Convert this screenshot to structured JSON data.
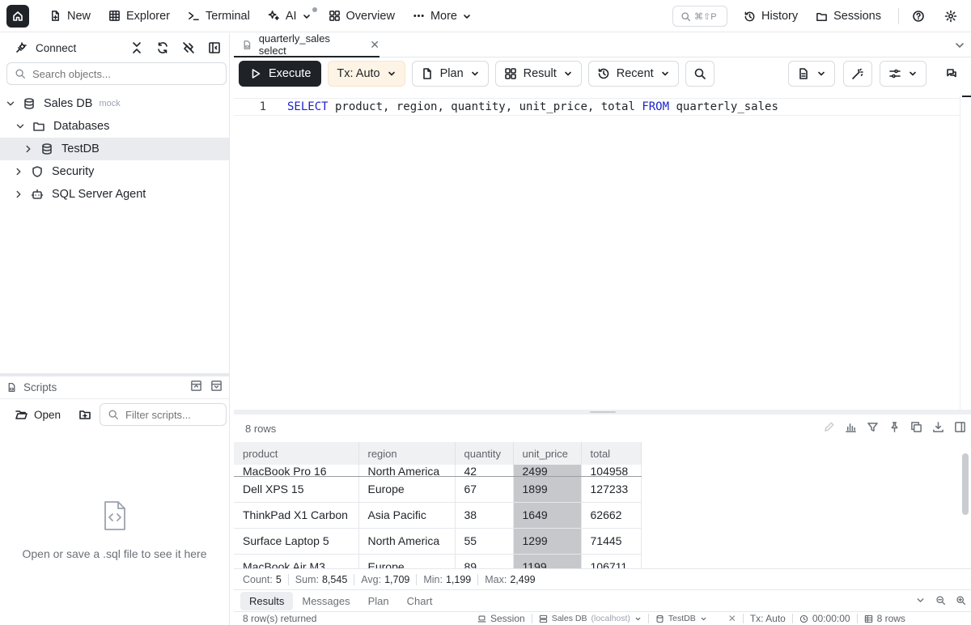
{
  "topnav": {
    "items": [
      {
        "label": "New",
        "icon": "new-file-icon"
      },
      {
        "label": "Explorer",
        "icon": "grid-table-icon"
      },
      {
        "label": "Terminal",
        "icon": "terminal-icon"
      },
      {
        "label": "AI",
        "icon": "sparkles-icon"
      },
      {
        "label": "Overview",
        "icon": "overview-grid-icon"
      },
      {
        "label": "More",
        "icon": "more-dots-icon"
      }
    ],
    "command_shortcut": "⌘⇧P",
    "history_label": "History",
    "sessions_label": "Sessions"
  },
  "connect": {
    "title": "Connect",
    "search_placeholder": "Search objects...",
    "tree": [
      {
        "label": "Sales DB",
        "badge": "mock"
      },
      {
        "label": "Databases"
      },
      {
        "label": "TestDB"
      },
      {
        "label": "Security"
      },
      {
        "label": "SQL Server Agent"
      }
    ]
  },
  "scripts": {
    "title": "Scripts",
    "open_label": "Open",
    "filter_placeholder": "Filter scripts...",
    "empty_text": "Open or save a .sql file to see it here"
  },
  "editor": {
    "tab_title": "quarterly_sales select",
    "toolbar": {
      "execute": "Execute",
      "tx": "Tx: Auto",
      "plan": "Plan",
      "result": "Result",
      "recent": "Recent"
    },
    "line_number": "1",
    "code": {
      "kw_select": "SELECT",
      "columns": " product, region, quantity, unit_price, total ",
      "kw_from": "FROM",
      "table": " quarterly_sales"
    }
  },
  "results": {
    "row_count_label": "8 rows",
    "columns": [
      "product",
      "region",
      "quantity",
      "unit_price",
      "total"
    ],
    "partial_top_row": [
      "MacBook Pro 16",
      "North America",
      "42",
      "2499",
      "104958"
    ],
    "rows": [
      [
        "Dell XPS 15",
        "Europe",
        "67",
        "1899",
        "127233"
      ],
      [
        "ThinkPad X1 Carbon",
        "Asia Pacific",
        "38",
        "1649",
        "62662"
      ],
      [
        "Surface Laptop 5",
        "North America",
        "55",
        "1299",
        "71445"
      ],
      [
        "MacBook Air M3",
        "Europe",
        "89",
        "1199",
        "106711"
      ]
    ],
    "stats": {
      "count_label": "Count:",
      "count": "5",
      "sum_label": "Sum:",
      "sum": "8,545",
      "avg_label": "Avg:",
      "avg": "1,709",
      "min_label": "Min:",
      "min": "1,199",
      "max_label": "Max:",
      "max": "2,499"
    },
    "tabs": [
      "Results",
      "Messages",
      "Plan",
      "Chart"
    ]
  },
  "statusbar": {
    "rows_returned": "8 row(s) returned",
    "session": "Session",
    "db": "Sales DB",
    "host": "(localhost)",
    "database": "TestDB",
    "tx": "Tx: Auto",
    "elapsed": "00:00:00",
    "rows": "8 rows"
  }
}
